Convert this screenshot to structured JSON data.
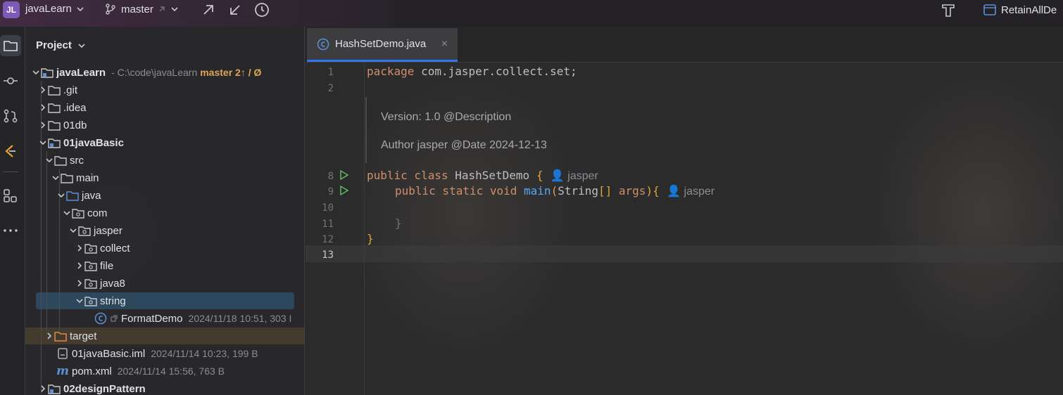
{
  "titlebar": {
    "project_badge": "JL",
    "project_name": "javaLearn",
    "branch": "master",
    "right_config": "RetainAllDe"
  },
  "project_panel": {
    "title": "Project",
    "tree": [
      {
        "label": "javaLearn",
        "meta": "- C:\\code\\javaLearn",
        "branch": "master 2↑ / Ø"
      },
      {
        "label": ".git"
      },
      {
        "label": ".idea"
      },
      {
        "label": "01db"
      },
      {
        "label": "01javaBasic"
      },
      {
        "label": "src"
      },
      {
        "label": "main"
      },
      {
        "label": "java"
      },
      {
        "label": "com"
      },
      {
        "label": "jasper"
      },
      {
        "label": "collect"
      },
      {
        "label": "file"
      },
      {
        "label": "java8"
      },
      {
        "label": "string"
      },
      {
        "label": "FormatDemo",
        "meta": "2024/11/18 10:51, 303 I"
      },
      {
        "label": "target"
      },
      {
        "label": "01javaBasic.iml",
        "meta": "2024/11/14 10:23, 199 B"
      },
      {
        "label": "pom.xml",
        "meta": "2024/11/14 15:56, 763 B"
      },
      {
        "label": "02designPattern"
      }
    ]
  },
  "editor": {
    "tab_label": "HashSetDemo.java",
    "line_numbers": [
      "1",
      "2",
      "8",
      "9",
      "10",
      "11",
      "12",
      "13"
    ],
    "lines": {
      "l1_kw": "package",
      "l1_rest": " com.jasper.collect.set;",
      "doc_version": "Version: 1.0 @Description",
      "doc_author": "Author   jasper @Date 2024-12-13",
      "l8_kw": "public class",
      "l8_name": " HashSetDemo ",
      "l8_brace": "{",
      "l8_author": "jasper",
      "l9_kw": "public static void",
      "l9_name": " main",
      "l9_paren1": "(",
      "l9_type": "String",
      "l9_arr": "[]",
      "l9_args": " args",
      "l9_paren2": ")",
      "l9_brace": "{",
      "l9_author": "jasper",
      "l11": "}",
      "l12": "}"
    }
  }
}
